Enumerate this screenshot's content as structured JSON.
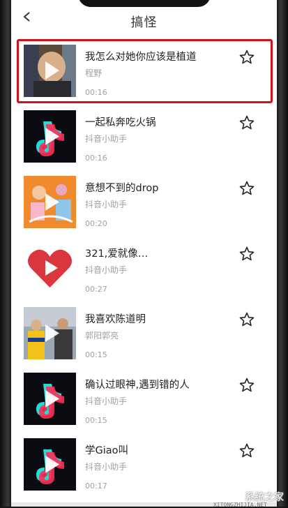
{
  "header": {
    "title": "搞怪"
  },
  "items": [
    {
      "title": "我怎么对她你应该是植道",
      "author": "程野",
      "duration": "00:16",
      "thumb": "person"
    },
    {
      "title": "一起私奔吃火锅",
      "author": "抖音小助手",
      "duration": "00:16",
      "thumb": "tiktok"
    },
    {
      "title": "意想不到的drop",
      "author": "抖音小助手",
      "duration": "00:20",
      "thumb": "orange"
    },
    {
      "title": "321,爱就像…",
      "author": "抖音小助手",
      "duration": "00:27",
      "thumb": "heart"
    },
    {
      "title": "我喜欢陈道明",
      "author": "郭阳郭亮",
      "duration": "00:15",
      "thumb": "people"
    },
    {
      "title": "确认过眼神,遇到错的人",
      "author": "抖音小助手",
      "duration": "00:15",
      "thumb": "tiktok"
    },
    {
      "title": "学Giao叫",
      "author": "抖音小助手",
      "duration": "00:17",
      "thumb": "tiktok"
    }
  ],
  "watermark": {
    "brand": "系统之家",
    "url": "XITONGZHIJIA.NET"
  },
  "colors": {
    "highlight": "#d3121d",
    "text": "#222222",
    "meta": "#a0a0a0"
  }
}
